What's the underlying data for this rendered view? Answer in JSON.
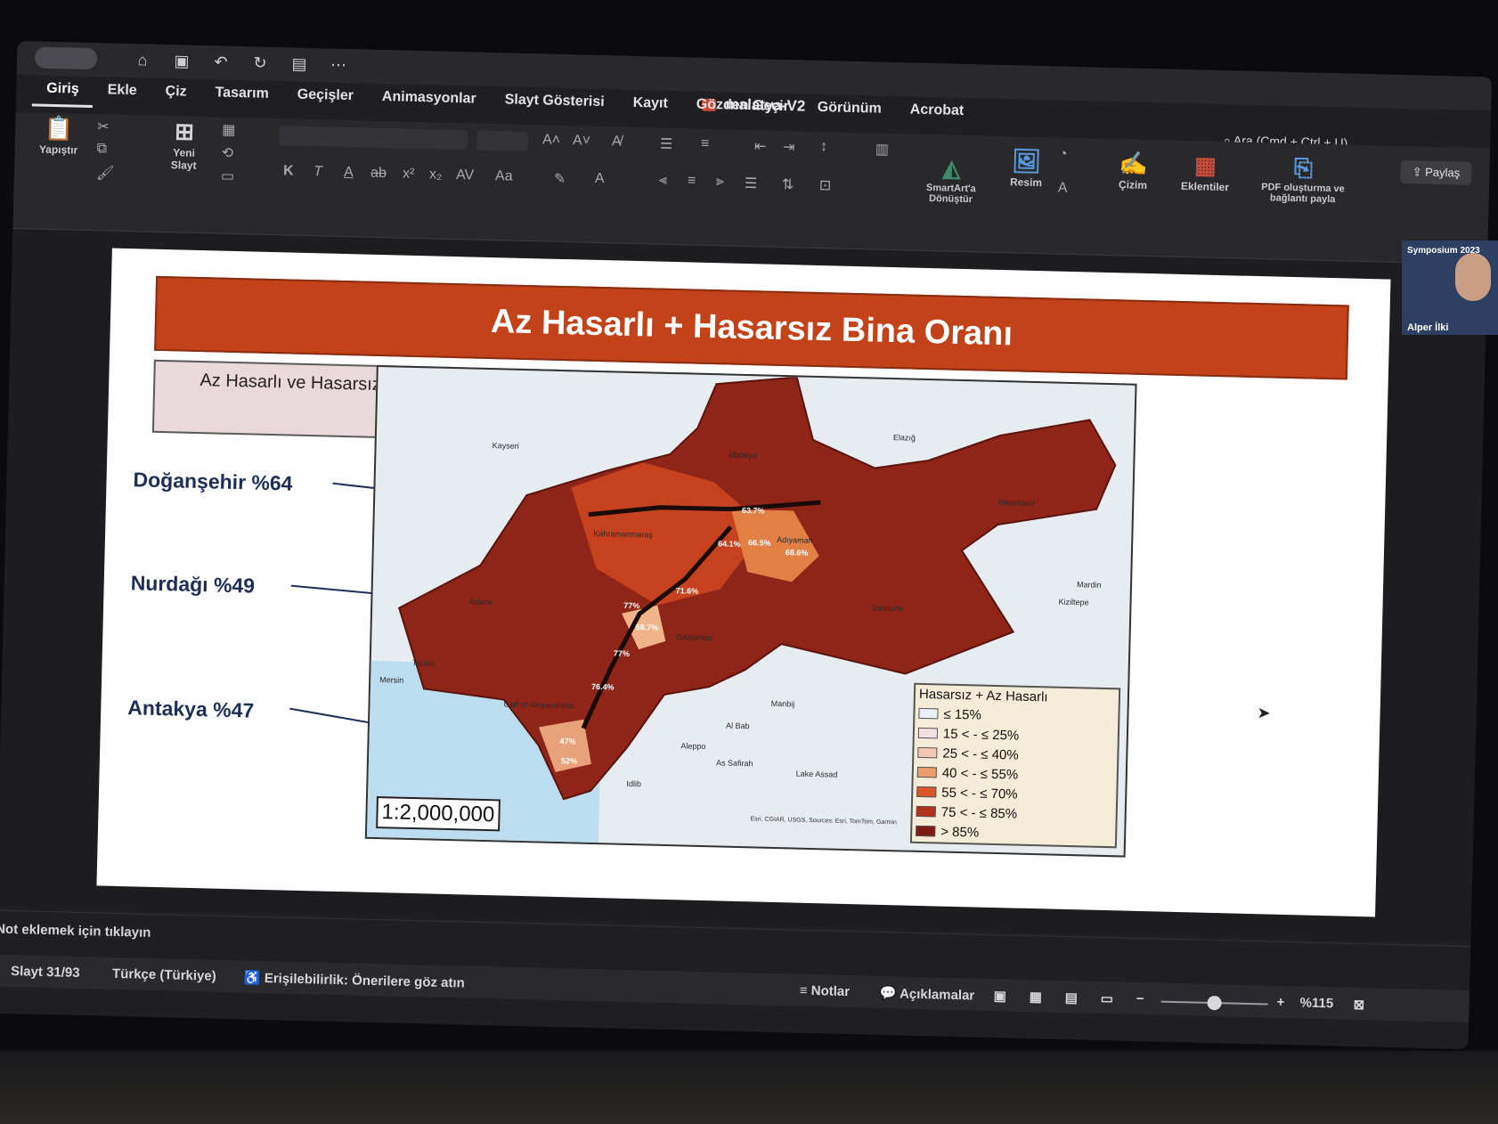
{
  "window": {
    "document_title": "malatya-V2",
    "search_placeholder": "Ara (Cmd + Ctrl + U)",
    "share_label": "Paylaş"
  },
  "tabs": [
    "Giriş",
    "Ekle",
    "Çiz",
    "Tasarım",
    "Geçişler",
    "Animasyonlar",
    "Slayt Gösterisi",
    "Kayıt",
    "Gözden Geçir",
    "Görünüm",
    "Acrobat"
  ],
  "ribbon": {
    "paste": "Yapıştır",
    "new_slide_1": "Yeni",
    "new_slide_2": "Slayt",
    "smartart_1": "SmartArt'a",
    "smartart_2": "Dönüştür",
    "picture": "Resim",
    "drawing": "Çizim",
    "addins": "Eklentiler",
    "pdf_1": "PDF oluşturma ve",
    "pdf_2": "bağlantı payla",
    "format_k": "K",
    "format_t": "T",
    "format_a": "A",
    "format_ab": "ab",
    "format_x2": "x²",
    "format_x_2": "x₂",
    "format_av": "AV",
    "format_aa": "Aa"
  },
  "slide": {
    "banner_title": "Az Hasarlı + Hasarsız Bina Oranı",
    "subtitle": "Az Hasarlı ve Hasarsız bina oranının ilçe ölçeğinde dağılımı.",
    "callouts": [
      {
        "text": "Doğanşehir %64"
      },
      {
        "text": "Nurdağı %49"
      },
      {
        "text": "Antakya %47"
      }
    ],
    "map": {
      "scale": "1:2,000,000",
      "legend_title": "Hasarsız + Az Hasarlı",
      "legend_items": [
        {
          "label": "≤ 15%",
          "color": "#e9eef7"
        },
        {
          "label": "15 < - ≤ 25%",
          "color": "#f1dfe1"
        },
        {
          "label": "25 < - ≤ 40%",
          "color": "#f2c9b2"
        },
        {
          "label": "40 < - ≤ 55%",
          "color": "#ec9d6d"
        },
        {
          "label": "55 < - ≤ 70%",
          "color": "#d9582a"
        },
        {
          "label": "75 < - ≤ 85%",
          "color": "#b2331c"
        },
        {
          "label": "> 85%",
          "color": "#7a1c14"
        }
      ],
      "place_labels": [
        "Malatya",
        "Diyarbakır",
        "Kahramanmaraş",
        "Adıyaman",
        "Adana",
        "Gaziantep",
        "Sanlıurfa",
        "Mersin",
        "Aleppo",
        "Idlib",
        "Gulf of Alexandretta",
        "Kayseri",
        "Mardin",
        "Kiziltepe",
        "Manbij",
        "Al Bab",
        "As Safirah",
        "Elazığ",
        "Tarsus",
        "Lake Assad"
      ],
      "value_labels": [
        "63.7%",
        "64.1%",
        "66.5%",
        "68.6%",
        "71.6%",
        "77%",
        "58.7%",
        "77%",
        "76.4%",
        "47%",
        "52%"
      ],
      "attribution": "Esri, CGIAR, USGS, Sources: Esri, TomTom, Garmin"
    }
  },
  "notes_placeholder": "Not eklemek için tıklayın",
  "status": {
    "slide_counter": "Slayt 31/93",
    "language": "Türkçe (Türkiye)",
    "accessibility": "Erişilebilirlik: Önerilere göz atın",
    "notes_btn": "Notlar",
    "comments_btn": "Açıklamalar",
    "zoom": "%115"
  },
  "webcam": {
    "name": "Alper İlki",
    "event": "Symposium 2023"
  },
  "colors": {
    "banner": "#c2421a",
    "callout_text": "#1d2f57",
    "map_region": "#8f2418"
  }
}
